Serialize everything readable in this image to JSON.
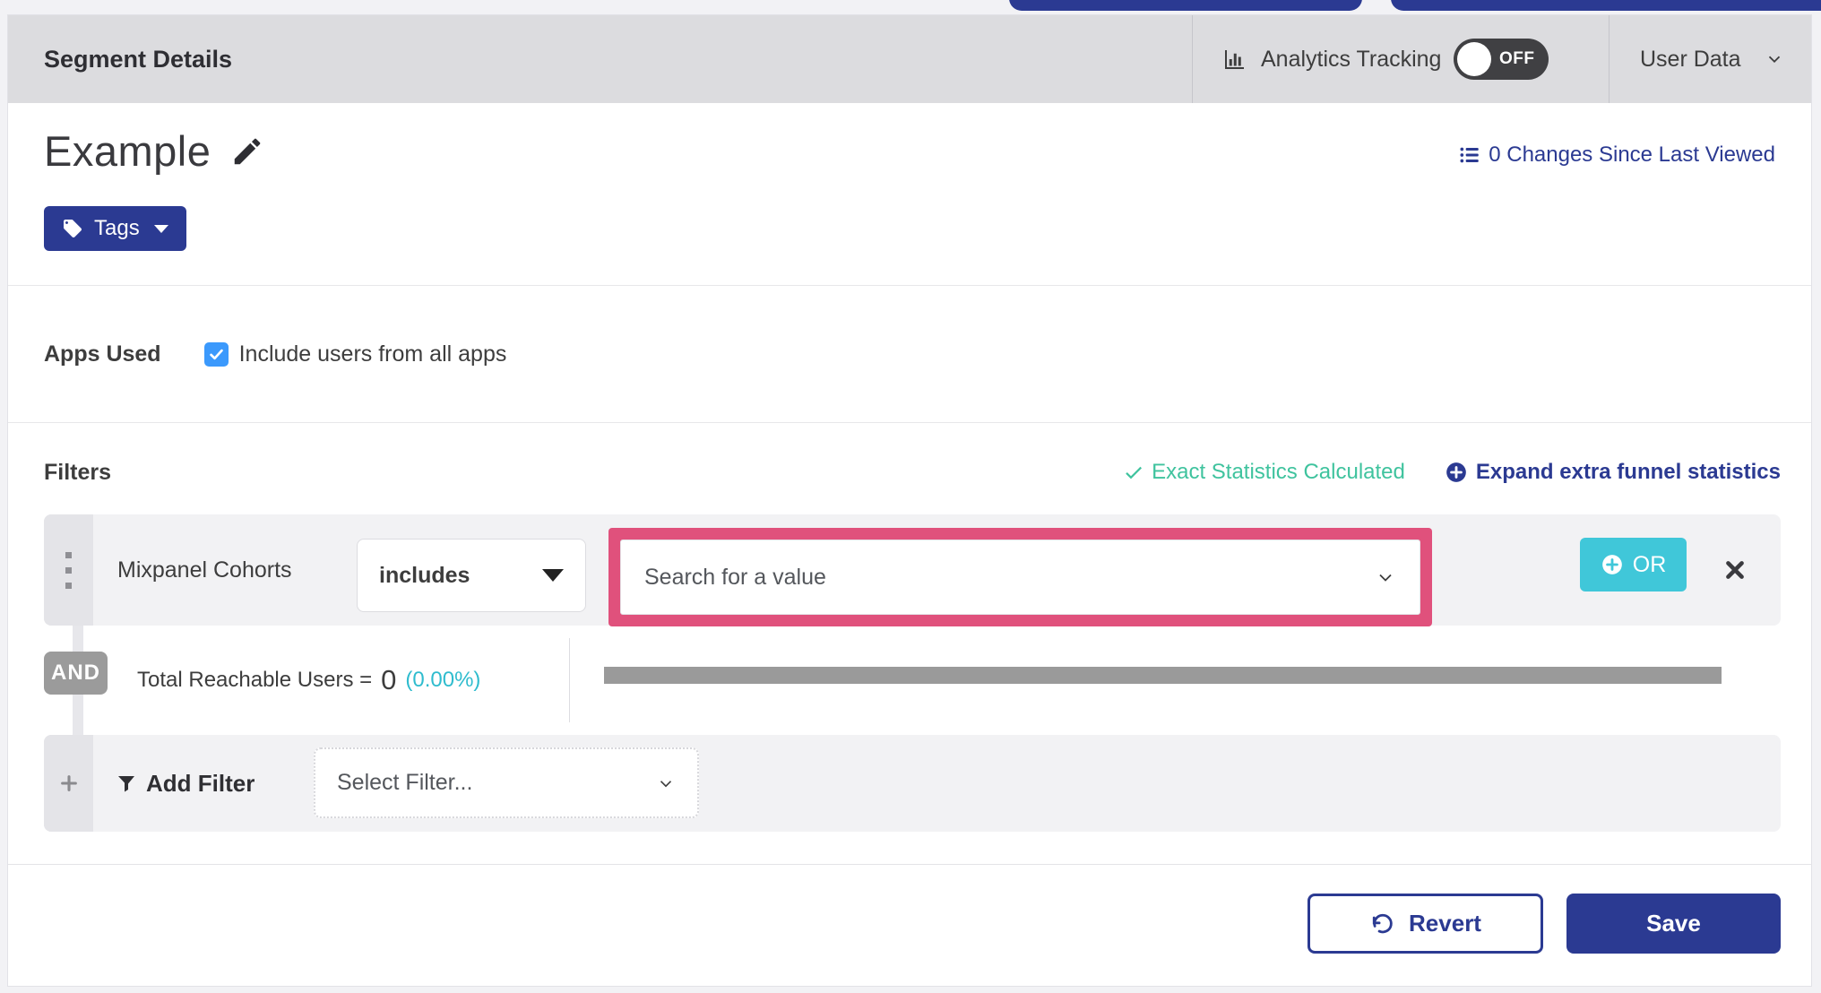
{
  "header": {
    "title": "Segment Details",
    "analytics": {
      "label": "Analytics Tracking",
      "state": "OFF"
    },
    "user_data": {
      "label": "User Data"
    }
  },
  "segment": {
    "name": "Example",
    "tags_label": "Tags",
    "changes_link": "0 Changes Since Last Viewed"
  },
  "apps": {
    "label": "Apps Used",
    "checkbox_label": "Include users from all apps",
    "checked": true
  },
  "filters": {
    "heading": "Filters",
    "exact_stats": "Exact Statistics Calculated",
    "expand_link": "Expand extra funnel statistics",
    "row": {
      "name": "Mixpanel Cohorts",
      "operator": "includes",
      "value_placeholder": "Search for a value",
      "or_label": "OR"
    },
    "and_label": "AND",
    "reachable": {
      "label": "Total Reachable Users =",
      "value": "0",
      "percent": "(0.00%)"
    },
    "add": {
      "label": "Add Filter",
      "placeholder": "Select Filter..."
    }
  },
  "footer": {
    "revert": "Revert",
    "save": "Save"
  },
  "colors": {
    "accent_indigo": "#2b3a92",
    "teal_button": "#40c7d9",
    "success_green": "#3fc39e",
    "percent_teal": "#2fbcce",
    "highlight_pink": "#e0517c",
    "checkbox_blue": "#3b99fc",
    "toggle_off": "#404043",
    "header_gray": "#dcdcdf"
  }
}
